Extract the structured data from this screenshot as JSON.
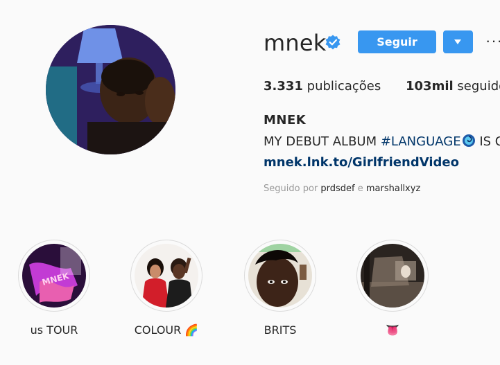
{
  "profile": {
    "username": "mnek",
    "verified": true,
    "follow_label": "Seguir",
    "more_label": "···",
    "stats": {
      "posts_count": "3.331",
      "posts_label": "publicações",
      "followers_count": "103mil",
      "followers_label": "seguidor"
    },
    "full_name": "MNEK",
    "bio": {
      "prefix": "MY DEBUT ALBUM ",
      "hashtag": "#LANGUAGE",
      "suffix": " IS O"
    },
    "link": "mnek.lnk.to/GirlfriendVideo",
    "followed_by": {
      "prefix": "Seguido por ",
      "user1": "prdsdef",
      "joiner": " e ",
      "user2": "marshallxyz"
    }
  },
  "highlights": [
    {
      "label": "us TOUR"
    },
    {
      "label": "COLOUR 🌈"
    },
    {
      "label": "BRITS"
    },
    {
      "label": "👅"
    }
  ],
  "colors": {
    "accent": "#3897f0",
    "link": "#003569",
    "text": "#262626",
    "muted": "#999999",
    "background": "#fafafa"
  }
}
